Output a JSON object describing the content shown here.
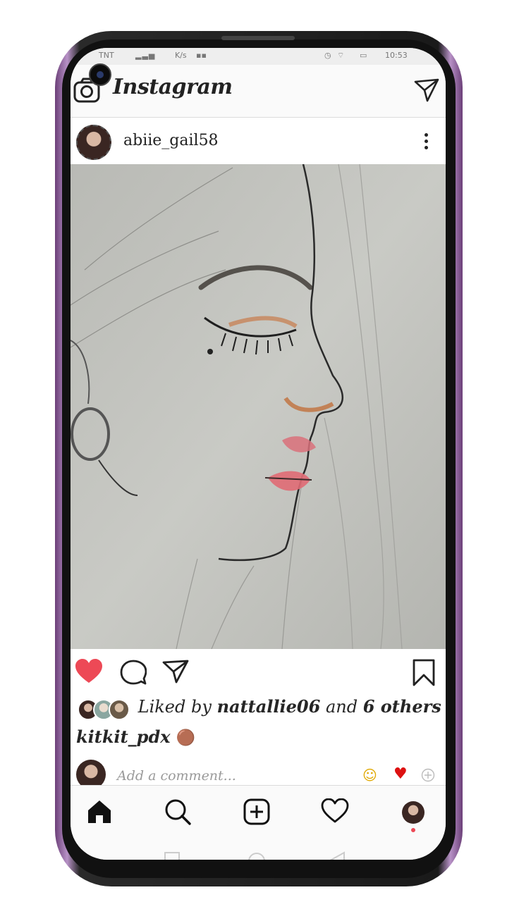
{
  "status_bar": {
    "carrier": "TNT",
    "speed": "K/s",
    "time": "10:53"
  },
  "app": {
    "title": "Instagram"
  },
  "post": {
    "username": "abiie_gail58",
    "liked_prefix": "Liked by",
    "liked_user": "nattallie06",
    "liked_joiner": "and",
    "liked_others": "6 others",
    "caption_user": "kitkit_pdx",
    "caption_emoji": "🟤",
    "comment_placeholder": "Add a comment...",
    "liked": true
  },
  "colors": {
    "like_red": "#ed4956",
    "text": "#262626",
    "accent_dot": "#ed4956"
  },
  "icons": {
    "appbar": [
      "camera-icon",
      "direct-message-icon"
    ],
    "actions": [
      "heart-icon",
      "comment-icon",
      "share-icon",
      "bookmark-icon"
    ],
    "quick_reactions": [
      "laughing-emoji-icon",
      "red-heart-emoji-icon",
      "add-emoji-icon"
    ],
    "nav": [
      "home-icon",
      "search-icon",
      "new-post-icon",
      "activity-heart-icon",
      "profile-avatar-icon"
    ]
  }
}
